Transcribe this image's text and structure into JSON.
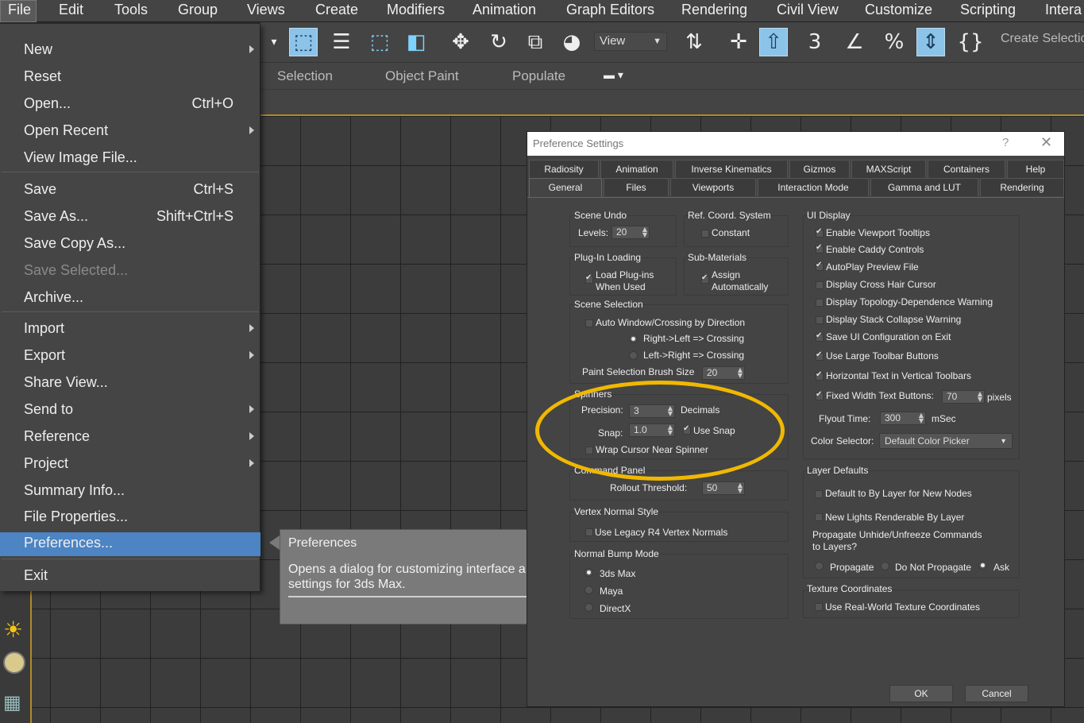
{
  "menubar": {
    "items": [
      "File",
      "Edit",
      "Tools",
      "Group",
      "Views",
      "Create",
      "Modifiers",
      "Animation",
      "Graph Editors",
      "Rendering",
      "Civil View",
      "Customize",
      "Scripting",
      "Intera"
    ]
  },
  "toolbar": {
    "view_dropdown": "View",
    "create_selection": "Create Selectio"
  },
  "ribbon": {
    "tabs": [
      "Selection",
      "Object Paint",
      "Populate"
    ]
  },
  "file_menu": {
    "items": [
      {
        "label": "New",
        "shortcut": "",
        "submenu": true
      },
      {
        "label": "Reset",
        "shortcut": "",
        "submenu": false
      },
      {
        "label": "Open...",
        "shortcut": "Ctrl+O",
        "submenu": false
      },
      {
        "label": "Open Recent",
        "shortcut": "",
        "submenu": true
      },
      {
        "label": "View Image File...",
        "shortcut": "",
        "submenu": false
      },
      {
        "label": "Save",
        "shortcut": "Ctrl+S",
        "submenu": false
      },
      {
        "label": "Save As...",
        "shortcut": "Shift+Ctrl+S",
        "submenu": false
      },
      {
        "label": "Save Copy As...",
        "shortcut": "",
        "submenu": false
      },
      {
        "label": "Save Selected...",
        "shortcut": "",
        "submenu": false,
        "disabled": true
      },
      {
        "label": "Archive...",
        "shortcut": "",
        "submenu": false
      },
      {
        "label": "Import",
        "shortcut": "",
        "submenu": true
      },
      {
        "label": "Export",
        "shortcut": "",
        "submenu": true
      },
      {
        "label": "Share View...",
        "shortcut": "",
        "submenu": false
      },
      {
        "label": "Send to",
        "shortcut": "",
        "submenu": true
      },
      {
        "label": "Reference",
        "shortcut": "",
        "submenu": true
      },
      {
        "label": "Project",
        "shortcut": "",
        "submenu": true
      },
      {
        "label": "Summary Info...",
        "shortcut": "",
        "submenu": false
      },
      {
        "label": "File Properties...",
        "shortcut": "",
        "submenu": false
      },
      {
        "label": "Preferences...",
        "shortcut": "",
        "submenu": false,
        "highlighted": true
      },
      {
        "label": "Exit",
        "shortcut": "",
        "submenu": false
      }
    ]
  },
  "tooltip": {
    "title": "Preferences",
    "body": "Opens a dialog for customizing interface a settings for 3ds Max."
  },
  "dialog": {
    "title": "Preference Settings",
    "help": "?",
    "close": "✕",
    "tabs_row1": [
      "Radiosity",
      "Animation",
      "Inverse Kinematics",
      "Gizmos",
      "MAXScript",
      "Containers",
      "Help"
    ],
    "tabs_row2": [
      "General",
      "Files",
      "Viewports",
      "Interaction Mode",
      "Gamma and LUT",
      "Rendering"
    ],
    "active_tab": "General",
    "scene_undo": {
      "title": "Scene Undo",
      "levels_label": "Levels:",
      "levels": "20"
    },
    "ref_coord": {
      "title": "Ref. Coord. System",
      "constant": "Constant",
      "constant_checked": false
    },
    "plugin_loading": {
      "title": "Plug-In Loading",
      "label1": "Load Plug-ins",
      "label2": "When Used",
      "checked": true
    },
    "sub_materials": {
      "title": "Sub-Materials",
      "label1": "Assign",
      "label2": "Automatically",
      "checked": true
    },
    "scene_selection": {
      "title": "Scene Selection",
      "auto_window": "Auto Window/Crossing by Direction",
      "auto_window_checked": false,
      "rl": "Right->Left => Crossing",
      "lr": "Left->Right => Crossing",
      "brush_label": "Paint Selection Brush Size",
      "brush_size": "20"
    },
    "spinners": {
      "title": "Spinners",
      "precision_label": "Precision:",
      "precision": "3",
      "decimals": "Decimals",
      "snap_label": "Snap:",
      "snap": "1.0",
      "use_snap": "Use Snap",
      "use_snap_checked": true,
      "wrap_cursor": "Wrap Cursor Near Spinner",
      "wrap_cursor_checked": false
    },
    "command_panel": {
      "title": "Command Panel",
      "rollout_label": "Rollout Threshold:",
      "rollout": "50"
    },
    "vertex_normal": {
      "title": "Vertex Normal Style",
      "legacy": "Use Legacy R4 Vertex Normals",
      "checked": false
    },
    "normal_bump": {
      "title": "Normal Bump Mode",
      "options": [
        "3ds Max",
        "Maya",
        "DirectX"
      ],
      "selected": "3ds Max"
    },
    "ui_display": {
      "title": "UI Display",
      "items": [
        {
          "label": "Enable Viewport Tooltips",
          "checked": true
        },
        {
          "label": "Enable Caddy Controls",
          "checked": true
        },
        {
          "label": "AutoPlay Preview File",
          "checked": true
        },
        {
          "label": "Display Cross Hair Cursor",
          "checked": false
        },
        {
          "label": "Display Topology-Dependence Warning",
          "checked": false
        },
        {
          "label": "Display Stack Collapse Warning",
          "checked": false
        },
        {
          "label": "Save UI Configuration on Exit",
          "checked": true
        },
        {
          "label": "Use Large Toolbar Buttons",
          "checked": true
        },
        {
          "label": "Horizontal Text in Vertical Toolbars",
          "checked": true
        }
      ],
      "fixed_width_label": "Fixed Width Text Buttons:",
      "fixed_width": "70",
      "pixels": "pixels",
      "fixed_width_checked": true,
      "flyout_label": "Flyout Time:",
      "flyout": "300",
      "msec": "mSec",
      "color_selector_label": "Color Selector:",
      "color_selector": "Default Color Picker"
    },
    "layer_defaults": {
      "title": "Layer Defaults",
      "default_by_layer": "Default to By Layer for New Nodes",
      "new_lights": "New Lights Renderable By Layer",
      "propagate_label1": "Propagate Unhide/Unfreeze Commands",
      "propagate_label2": "to Layers?",
      "options": [
        "Propagate",
        "Do Not Propagate",
        "Ask"
      ],
      "selected": "Ask"
    },
    "texture_coords": {
      "title": "Texture Coordinates",
      "real_world": "Use Real-World Texture Coordinates",
      "checked": false
    },
    "ok": "OK",
    "cancel": "Cancel"
  },
  "colors": {
    "highlight_ellipse": "#f0b800",
    "menu_highlight": "#4c84c4"
  }
}
